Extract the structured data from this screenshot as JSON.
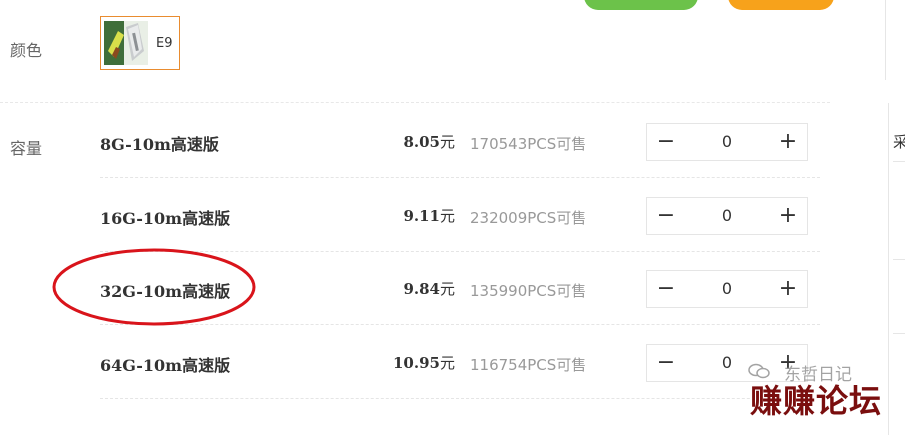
{
  "attributes": {
    "color_label": "颜色",
    "capacity_label": "容量",
    "color_option": {
      "name": "E9",
      "image_icon": "usb-flash-drive-image",
      "selected": true
    }
  },
  "sku_rows": [
    {
      "name": "8G-10m高速版",
      "price": "8.05",
      "price_unit": "元",
      "stock": "170543PCS可售",
      "quantity": "0"
    },
    {
      "name": "16G-10m高速版",
      "price": "9.11",
      "price_unit": "元",
      "stock": "232009PCS可售",
      "quantity": "0"
    },
    {
      "name": "32G-10m高速版",
      "price": "9.84",
      "price_unit": "元",
      "stock": "135990PCS可售",
      "quantity": "0"
    },
    {
      "name": "64G-10m高速版",
      "price": "10.95",
      "price_unit": "元",
      "stock": "116754PCS可售",
      "quantity": "0"
    }
  ],
  "stepper": {
    "minus_symbol": "−",
    "plus_symbol": "+"
  },
  "right_panel": {
    "partial_glyph": "采"
  },
  "watermark": {
    "wechat_text": "东哲日记",
    "forum_text": "赚赚论坛"
  },
  "annotation": {
    "highlighted_row": "32G-10m高速版",
    "color": "#d9141b"
  },
  "colors": {
    "accent_green": "#6cc24a",
    "accent_orange": "#f7a21b",
    "selected_border": "#e98c2f"
  }
}
